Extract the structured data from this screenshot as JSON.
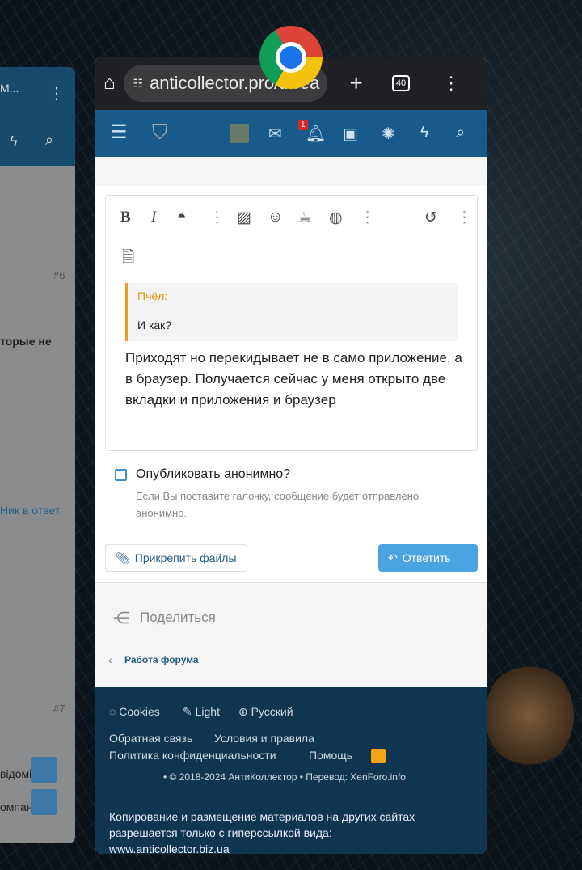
{
  "background_app": {
    "title_fragment": "M...",
    "post_numbers": [
      "#6",
      "#7"
    ],
    "snippets": [
      "торые не",
      "Ник в ответ",
      "відомі",
      "омпаніях"
    ]
  },
  "browser": {
    "url": "anticollector.pro/threa",
    "tab_count": "40",
    "icons": [
      "home-icon",
      "site-settings-icon",
      "new-tab-icon",
      "tabs-icon",
      "menu-icon"
    ]
  },
  "site_nav": {
    "notification_count": "1",
    "icons": [
      "menu-icon",
      "logo-icon",
      "avatar",
      "mail-icon",
      "bell-icon",
      "money-icon",
      "bulb-icon",
      "lightning-icon",
      "search-icon"
    ]
  },
  "editor": {
    "quote_author": "Пчёл:",
    "quote_text": "И как?",
    "message": "Приходят но перекидывает не в само приложение, а в браузер. Получается сейчас у меня открыто две вкладки и приложения и браузер"
  },
  "anonymous": {
    "label": "Опубликовать анонимно?",
    "hint": "Если Вы поставите галочку, сообщение будет отправлено анонимно."
  },
  "actions": {
    "attach": "Прикрепить файлы",
    "reply": "Ответить",
    "share": "Поделиться",
    "breadcrumb": "Работа форума"
  },
  "footer": {
    "cookies": "Cookies",
    "light": "Light",
    "language": "Русский",
    "links": [
      "Обратная связь",
      "Условия и правила",
      "Политика конфиденциальности",
      "Помощь"
    ],
    "copyright": "• © 2018-2024 АнтиКоллектор • Перевод: XenForo.info",
    "notice": "Копирование и размещение материалов на других сайтах разрешается только с гиперссылкой вида:",
    "site": "www.anticollector.biz.ua"
  },
  "colors": {
    "nav": "#185b8a",
    "footer": "#10354f",
    "accent": "#4aa3df",
    "rss": "#f7a21b"
  }
}
